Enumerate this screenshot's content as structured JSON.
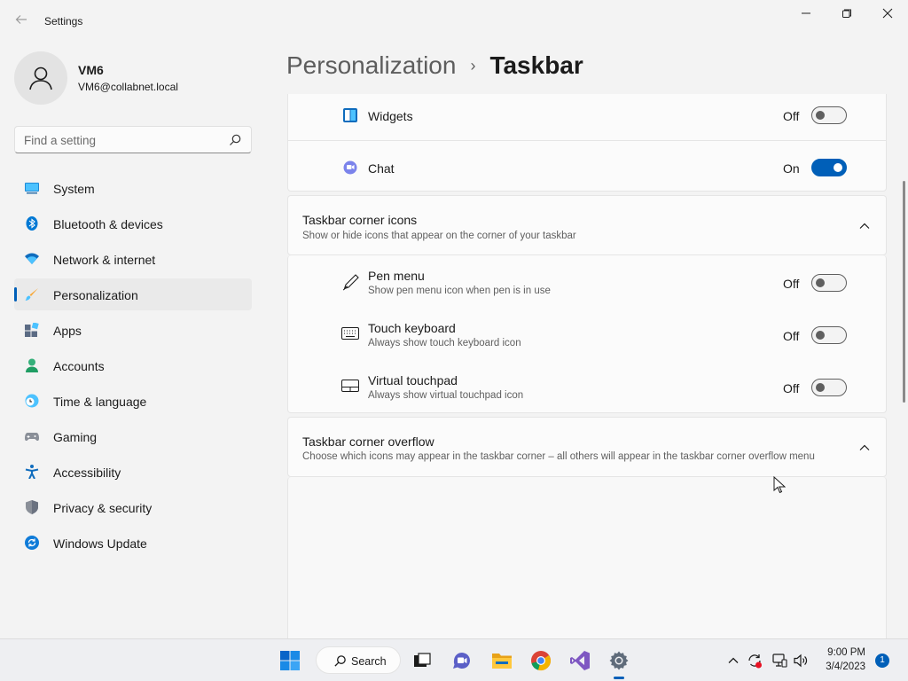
{
  "window": {
    "title": "Settings",
    "back_icon": "arrow-left-icon",
    "controls": [
      "minimize-icon",
      "restore-icon",
      "close-icon"
    ]
  },
  "user": {
    "name": "VM6",
    "email": "VM6@collabnet.local"
  },
  "search": {
    "placeholder": "Find a setting"
  },
  "sidebar": {
    "items": [
      {
        "label": "System",
        "icon": "monitor-icon"
      },
      {
        "label": "Bluetooth & devices",
        "icon": "bluetooth-icon"
      },
      {
        "label": "Network & internet",
        "icon": "wifi-icon"
      },
      {
        "label": "Personalization",
        "icon": "paintbrush-icon",
        "active": true
      },
      {
        "label": "Apps",
        "icon": "apps-icon"
      },
      {
        "label": "Accounts",
        "icon": "person-icon"
      },
      {
        "label": "Time & language",
        "icon": "clock-globe-icon"
      },
      {
        "label": "Gaming",
        "icon": "gamepad-icon"
      },
      {
        "label": "Accessibility",
        "icon": "accessibility-icon"
      },
      {
        "label": "Privacy & security",
        "icon": "shield-icon"
      },
      {
        "label": "Windows Update",
        "icon": "refresh-icon"
      }
    ]
  },
  "breadcrumb": {
    "parent": "Personalization",
    "separator": "›",
    "current": "Taskbar"
  },
  "taskbar_items": {
    "widgets": {
      "label": "Widgets",
      "state": "Off",
      "on": false
    },
    "chat": {
      "label": "Chat",
      "state": "On",
      "on": true
    }
  },
  "corner_icons": {
    "title": "Taskbar corner icons",
    "subtitle": "Show or hide icons that appear on the corner of your taskbar",
    "items": [
      {
        "label": "Pen menu",
        "desc": "Show pen menu icon when pen is in use",
        "state": "Off",
        "icon": "pen-icon"
      },
      {
        "label": "Touch keyboard",
        "desc": "Always show touch keyboard icon",
        "state": "Off",
        "icon": "keyboard-icon"
      },
      {
        "label": "Virtual touchpad",
        "desc": "Always show virtual touchpad icon",
        "state": "Off",
        "icon": "touchpad-icon"
      }
    ]
  },
  "corner_overflow": {
    "title": "Taskbar corner overflow",
    "subtitle": "Choose which icons may appear in the taskbar corner – all others will appear in the taskbar corner overflow menu"
  },
  "taskbar": {
    "search_label": "Search",
    "apps": [
      "windows-start-icon",
      "search-icon",
      "task-view-icon",
      "teams-chat-icon",
      "file-explorer-icon",
      "chrome-icon",
      "visual-studio-icon",
      "settings-gear-icon"
    ],
    "clock_time": "9:00 PM",
    "clock_date": "3/4/2023",
    "notification_count": "1"
  },
  "colors": {
    "accent": "#005fb8",
    "background": "#f3f3f3",
    "card": "#fbfbfb"
  }
}
